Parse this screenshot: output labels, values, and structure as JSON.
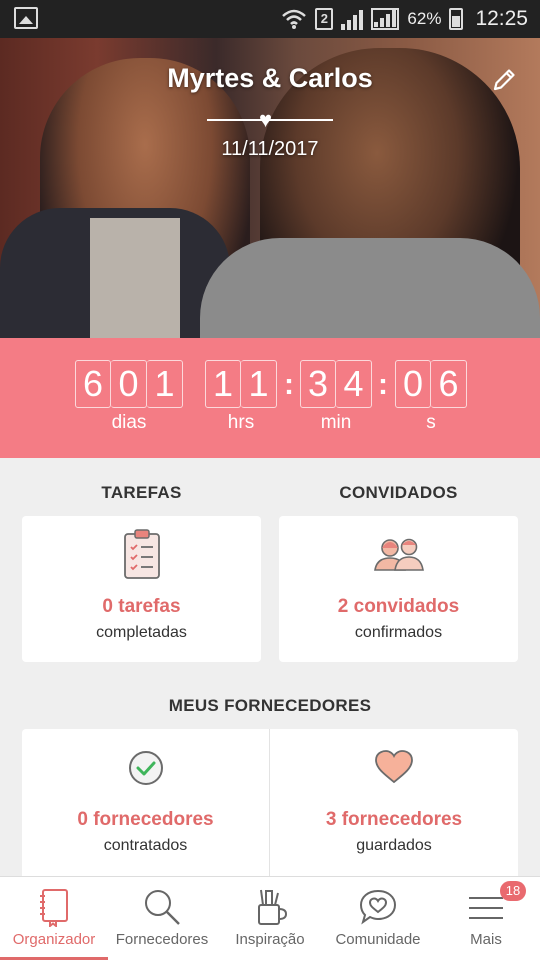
{
  "status_bar": {
    "sim_slot": "2",
    "battery": "62%",
    "time": "12:25"
  },
  "hero": {
    "title": "Myrtes & Carlos",
    "date": "11/11/2017"
  },
  "countdown": {
    "days_digits": [
      "6",
      "0",
      "1"
    ],
    "hours_digits": [
      "1",
      "1"
    ],
    "minutes_digits": [
      "3",
      "4"
    ],
    "seconds_digits": [
      "0",
      "6"
    ],
    "separator": ":",
    "labels": {
      "days": "dias",
      "hours": "hrs",
      "minutes": "min",
      "seconds": "s"
    }
  },
  "tarefas": {
    "title": "TAREFAS",
    "count": "0 tarefas",
    "sub": "completadas",
    "icon": "clipboard-icon"
  },
  "convidados": {
    "title": "CONVIDADOS",
    "count": "2 convidados",
    "sub": "confirmados",
    "icon": "guests-icon"
  },
  "fornecedores": {
    "title": "MEUS FORNECEDORES",
    "contratados": {
      "count": "0 fornecedores",
      "sub": "contratados",
      "icon": "check-circle-icon"
    },
    "guardados": {
      "count": "3 fornecedores",
      "sub": "guardados",
      "icon": "heart-icon"
    }
  },
  "bottom_nav": {
    "items": [
      {
        "label": "Organizador",
        "icon": "notebook-icon",
        "active": true
      },
      {
        "label": "Fornecedores",
        "icon": "search-icon",
        "active": false
      },
      {
        "label": "Inspiração",
        "icon": "pencil-cup-icon",
        "active": false
      },
      {
        "label": "Comunidade",
        "icon": "chat-heart-icon",
        "active": false
      },
      {
        "label": "Mais",
        "icon": "menu-icon",
        "active": false
      }
    ],
    "badge": "18"
  },
  "colors": {
    "accent": "#f47c85",
    "accent_text": "#e06a6a",
    "background": "#efefef"
  }
}
